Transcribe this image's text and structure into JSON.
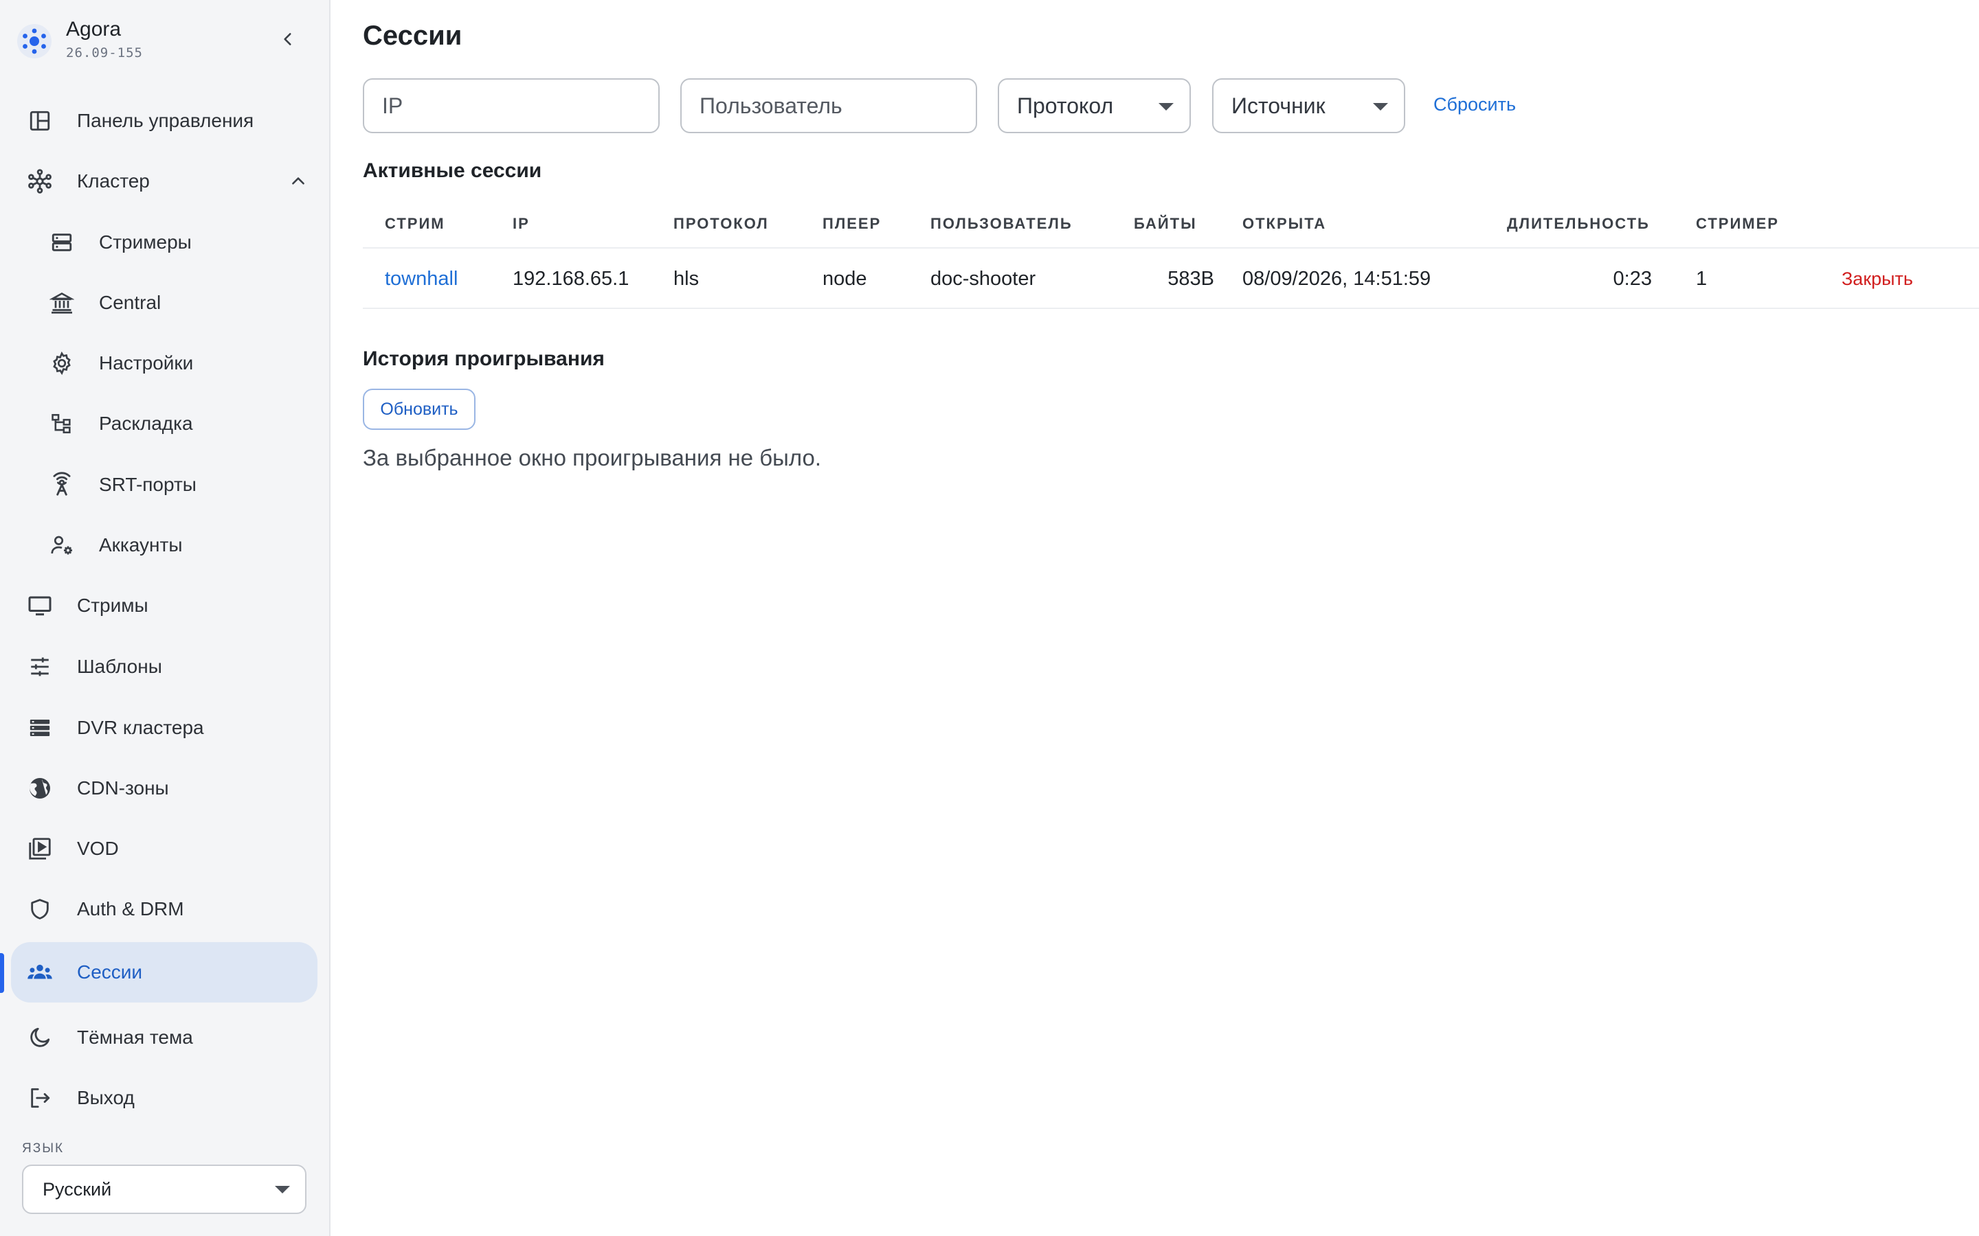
{
  "app": {
    "name": "Agora",
    "version": "26.09-155"
  },
  "sidebar": {
    "items": [
      {
        "label": "Панель управления",
        "icon": "dashboard-icon"
      },
      {
        "label": "Кластер",
        "icon": "cluster-icon",
        "expanded": true
      },
      {
        "label": "Стримеры",
        "icon": "server-icon",
        "sub": true
      },
      {
        "label": "Central",
        "icon": "bank-icon",
        "sub": true
      },
      {
        "label": "Настройки",
        "icon": "gear-icon",
        "sub": true
      },
      {
        "label": "Раскладка",
        "icon": "layout-tree-icon",
        "sub": true
      },
      {
        "label": "SRT-порты",
        "icon": "antenna-icon",
        "sub": true
      },
      {
        "label": "Аккаунты",
        "icon": "user-gear-icon",
        "sub": true
      },
      {
        "label": "Стримы",
        "icon": "monitor-icon"
      },
      {
        "label": "Шаблоны",
        "icon": "sliders-icon"
      },
      {
        "label": "DVR кластера",
        "icon": "storage-icon"
      },
      {
        "label": "CDN-зоны",
        "icon": "globe-icon"
      },
      {
        "label": "VOD",
        "icon": "video-library-icon"
      },
      {
        "label": "Auth & DRM",
        "icon": "shield-icon"
      },
      {
        "label": "Сессии",
        "icon": "people-icon",
        "active": true
      },
      {
        "label": "Тёмная тема",
        "icon": "moon-icon"
      },
      {
        "label": "Выход",
        "icon": "logout-icon"
      }
    ],
    "language_label": "ЯЗЫК",
    "language_value": "Русский"
  },
  "page": {
    "title": "Сессии",
    "filters": {
      "ip_placeholder": "IP",
      "user_placeholder": "Пользователь",
      "protocol_value": "Протокол",
      "source_value": "Источник",
      "reset_label": "Сбросить"
    },
    "active": {
      "title": "Активные сессии",
      "columns": [
        "СТРИМ",
        "IP",
        "ПРОТОКОЛ",
        "ПЛЕЕР",
        "ПОЛЬЗОВАТЕЛЬ",
        "БАЙТЫ",
        "ОТКРЫТА",
        "ДЛИТЕЛЬНОСТЬ",
        "СТРИМЕР"
      ],
      "rows": [
        {
          "stream": "townhall",
          "ip": "192.168.65.1",
          "protocol": "hls",
          "player": "node",
          "user": "doc-shooter",
          "bytes": "583B",
          "opened": "08/09/2026, 14:51:59",
          "duration": "0:23",
          "streamer": "1",
          "action": "Закрыть"
        }
      ]
    },
    "history": {
      "title": "История проигрывания",
      "refresh_label": "Обновить",
      "empty_text": "За выбранное окно проигрывания не было."
    }
  },
  "colors": {
    "accent": "#1f6fd6",
    "active_bg": "#dde6f4",
    "danger": "#d11f1f",
    "sidebar_bg": "#f4f5f7"
  }
}
